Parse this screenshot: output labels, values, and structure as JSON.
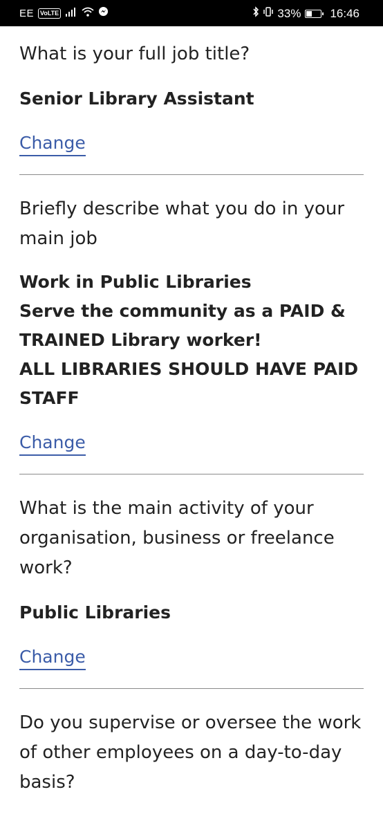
{
  "status_bar": {
    "carrier": "EE",
    "volte": "VoLTE",
    "battery_percent": "33%",
    "time": "16:46",
    "icons": [
      "signal-icon",
      "wifi-icon",
      "messenger-icon",
      "bluetooth-icon",
      "vibrate-icon",
      "battery-icon"
    ]
  },
  "sections": [
    {
      "question": "What is your full job title?",
      "answer": "Senior Library Assistant",
      "link": "Change"
    },
    {
      "question": "Briefly describe what you do in your main job",
      "answer": "Work in Public Libraries\nServe the community as a PAID & TRAINED Library worker!\nALL LIBRARIES SHOULD HAVE PAID STAFF",
      "link": "Change"
    },
    {
      "question": "What is the main activity of your organisation, business or freelance work?",
      "answer": "Public Libraries",
      "link": "Change"
    },
    {
      "question": "Do you supervise or oversee the work of other employees on a day-to-day basis?"
    }
  ]
}
